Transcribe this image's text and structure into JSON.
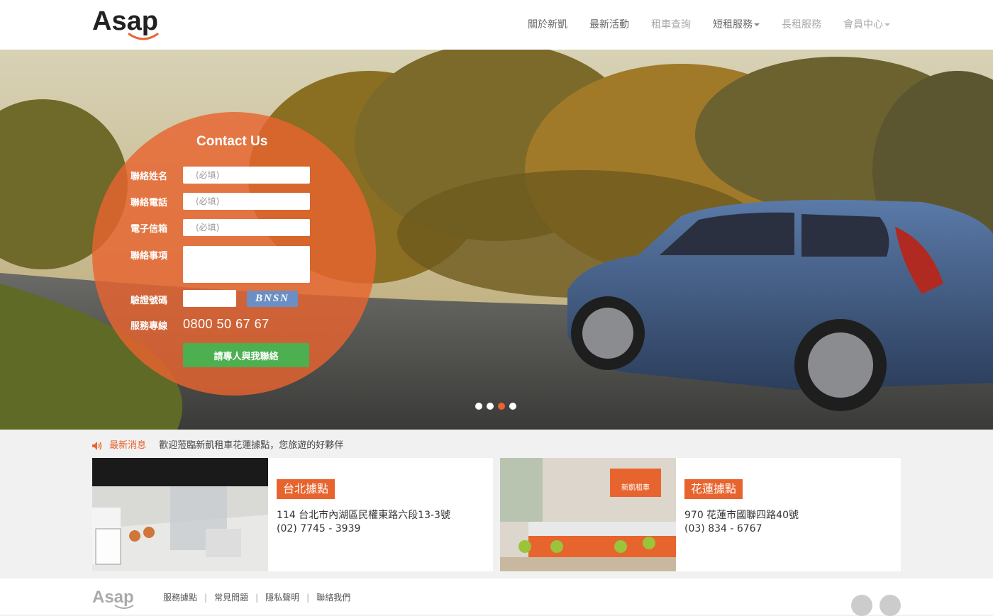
{
  "brand": {
    "name": "Asap",
    "accent": "#e8642e"
  },
  "nav": [
    {
      "label": "關於新凱"
    },
    {
      "label": "最新活動"
    },
    {
      "label": "租車查詢"
    },
    {
      "label": "短租服務"
    },
    {
      "label": "長租服務"
    },
    {
      "label": "會員中心"
    }
  ],
  "contact": {
    "title": "Contact Us",
    "name_label": "聯絡姓名",
    "name_placeholder": "(必填)",
    "phone_label": "聯絡電話",
    "phone_placeholder": "(必填)",
    "email_label": "電子信箱",
    "email_placeholder": "(必填)",
    "message_label": "聯絡事項",
    "captcha_label": "驗證號碼",
    "captcha_text": "BNSN",
    "hotline_label": "服務專線",
    "hotline": "0800 50 67 67",
    "submit": "請專人與我聯絡"
  },
  "slider": {
    "count": 4,
    "active": 3
  },
  "news": {
    "label": "最新消息",
    "text": "歡迎蒞臨新凱租車花蓮據點，您旅遊的好夥伴"
  },
  "locations": [
    {
      "title": "台北據點",
      "address": "114 台北市內湖區民權東路六段13-3號",
      "phone": "(02) 7745 - 3939"
    },
    {
      "title": "花蓮據點",
      "address": "970 花蓮市國聯四路40號",
      "phone": "(03) 834 - 6767",
      "sign": "新凱租車"
    }
  ],
  "footer": {
    "links": [
      "服務據點",
      "常見問題",
      "隱私聲明",
      "聯絡我們"
    ]
  }
}
